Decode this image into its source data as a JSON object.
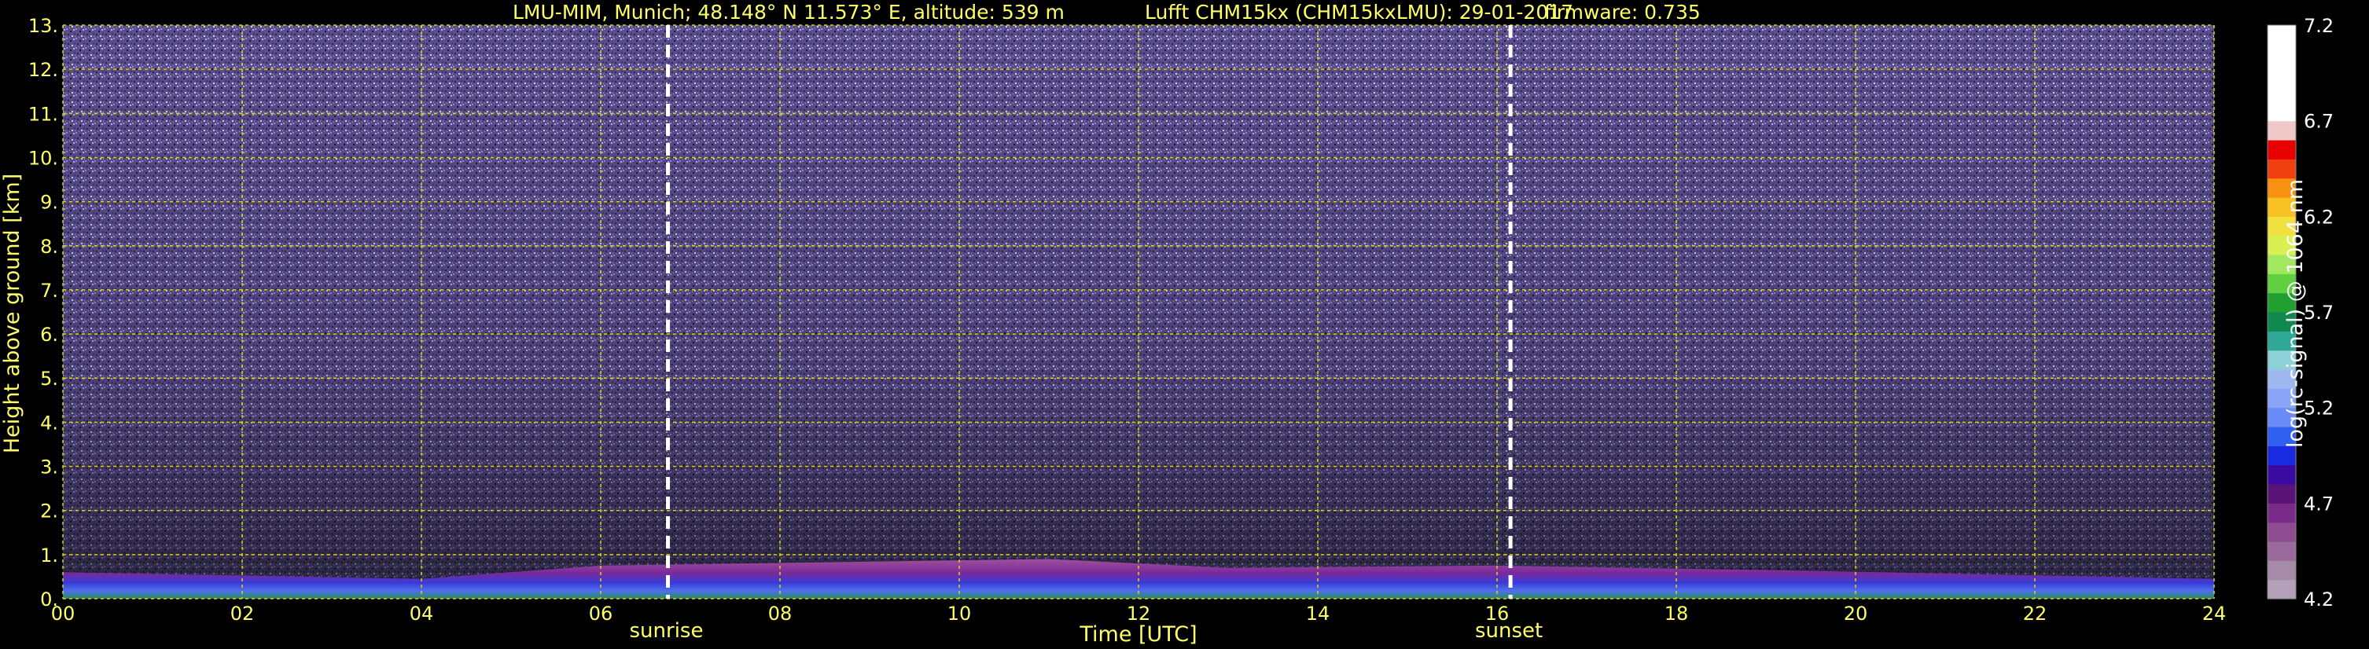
{
  "chart_data": {
    "type": "heatmap",
    "title_parts": [
      "LMU-MIM, Munich; 48.148° N 11.573° E, altitude: 539 m",
      "Lufft CHM15kx (CHM15kxLMU): 29-01-2017",
      "firmware: 0.735"
    ],
    "xlabel": "Time [UTC]",
    "ylabel": "Height above ground [km]",
    "xlim": [
      0,
      24
    ],
    "ylim": [
      0,
      13
    ],
    "x_ticks": [
      "00",
      "02",
      "04",
      "06",
      "08",
      "10",
      "12",
      "14",
      "16",
      "18",
      "20",
      "22",
      "24"
    ],
    "y_ticks": [
      "0.",
      "1.",
      "2.",
      "3.",
      "4.",
      "5.",
      "6.",
      "7.",
      "8.",
      "9.",
      "10.",
      "11.",
      "12.",
      "13."
    ],
    "grid": true,
    "colorbar": {
      "label": "log(rc-signal) @ 1064 nm",
      "range": [
        4.2,
        7.2
      ],
      "ticks": [
        "4.2",
        "4.7",
        "5.2",
        "5.7",
        "6.2",
        "6.7",
        "7.2"
      ]
    },
    "events": [
      {
        "name": "sunrise",
        "time": 6.75
      },
      {
        "name": "sunset",
        "time": 16.15
      }
    ],
    "aerosol_layer_top_km": [
      {
        "time": 0,
        "top": 0.6
      },
      {
        "time": 4,
        "top": 0.45
      },
      {
        "time": 6,
        "top": 0.75
      },
      {
        "time": 11,
        "top": 0.9
      },
      {
        "time": 13,
        "top": 0.7
      },
      {
        "time": 16,
        "top": 0.75
      },
      {
        "time": 19,
        "top": 0.65
      },
      {
        "time": 24,
        "top": 0.45
      }
    ],
    "noise_background": "purple/blue speckle throughout 1–13 km"
  },
  "colors": {
    "axis_text": "#ffff66",
    "grid": "#d8d800",
    "event_line": "#ffffff",
    "background": "#000000"
  }
}
